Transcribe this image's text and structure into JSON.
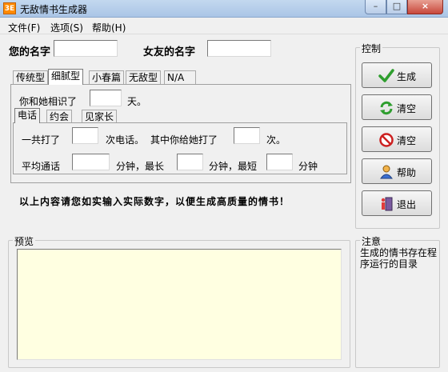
{
  "window": {
    "title": "无敌情书生成器",
    "icon_text": "3E"
  },
  "menu": [
    {
      "label": "文件(F)"
    },
    {
      "label": "选项(S)"
    },
    {
      "label": "帮助(H)"
    }
  ],
  "form": {
    "your_name_label": "您的名字",
    "your_name_value": "",
    "girlfriend_name_label": "女友的名字",
    "girlfriend_name_value": ""
  },
  "style_tabs": [
    {
      "label": "传统型",
      "active": false
    },
    {
      "label": "细腻型",
      "active": true
    },
    {
      "label": "小春篇",
      "active": false
    },
    {
      "label": "无敌型",
      "active": false
    },
    {
      "label": "N/A",
      "active": false
    }
  ],
  "tab_content": {
    "known_prefix": "你和她相识了",
    "known_days": "",
    "known_suffix": "天。",
    "sub_tabs": [
      {
        "label": "电话",
        "active": true
      },
      {
        "label": "约会",
        "active": false
      },
      {
        "label": "见家长",
        "active": false
      }
    ],
    "phone": {
      "total_prefix": "一共打了",
      "total_calls": "",
      "total_suffix": "次电话。",
      "you_called_prefix": "其中你给她打了",
      "you_called": "",
      "you_called_suffix": "次。",
      "avg_prefix": "平均通话",
      "avg_minutes": "",
      "longest_prefix": "分钟，最长",
      "longest_minutes": "",
      "shortest_prefix": "分钟，最短",
      "shortest_minutes": "",
      "shortest_suffix": "分钟"
    }
  },
  "instruction": "以上内容请您如实输入实际数字，以便生成高质量的情书！",
  "preview": {
    "title": "预览",
    "content": ""
  },
  "control": {
    "title": "控制",
    "buttons": [
      {
        "label": "生成",
        "icon": "check-icon"
      },
      {
        "label": "清空",
        "icon": "refresh-icon"
      },
      {
        "label": "清空",
        "icon": "stop-icon"
      },
      {
        "label": "帮助",
        "icon": "help-icon"
      },
      {
        "label": "退出",
        "icon": "exit-icon"
      }
    ]
  },
  "note": {
    "title": "注意",
    "text": "生成的情书存在程序运行的目录"
  },
  "colors": {
    "preview_bg": "#ffffe1",
    "generate_check": "#2e9e2e",
    "stop_red": "#cc2020"
  }
}
